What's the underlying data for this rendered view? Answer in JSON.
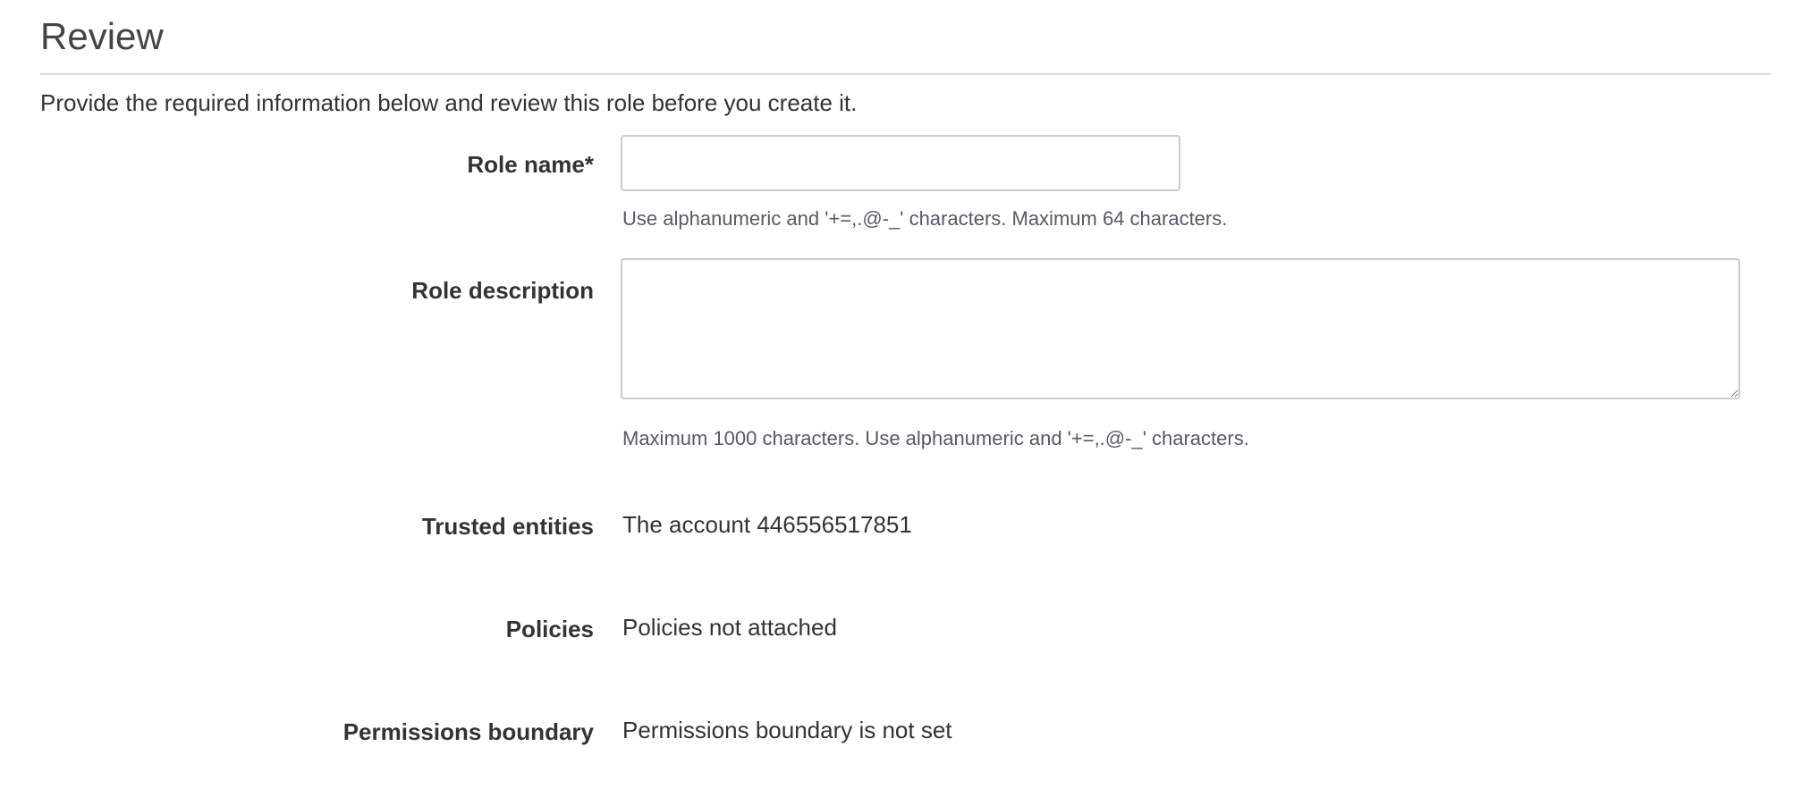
{
  "section": {
    "title": "Review",
    "intro": "Provide the required information below and review this role before you create it."
  },
  "form": {
    "role_name": {
      "label": "Role name*",
      "value": "",
      "placeholder": "",
      "help": "Use alphanumeric and '+=,.@-_' characters. Maximum 64 characters."
    },
    "role_description": {
      "label": "Role description",
      "value": "",
      "placeholder": "",
      "help": "Maximum 1000 characters. Use alphanumeric and '+=,.@-_' characters."
    },
    "trusted_entities": {
      "label": "Trusted entities",
      "value": "The account 446556517851"
    },
    "policies": {
      "label": "Policies",
      "value": "Policies not attached"
    },
    "permissions_boundary": {
      "label": "Permissions boundary",
      "value": "Permissions boundary is not set"
    }
  }
}
